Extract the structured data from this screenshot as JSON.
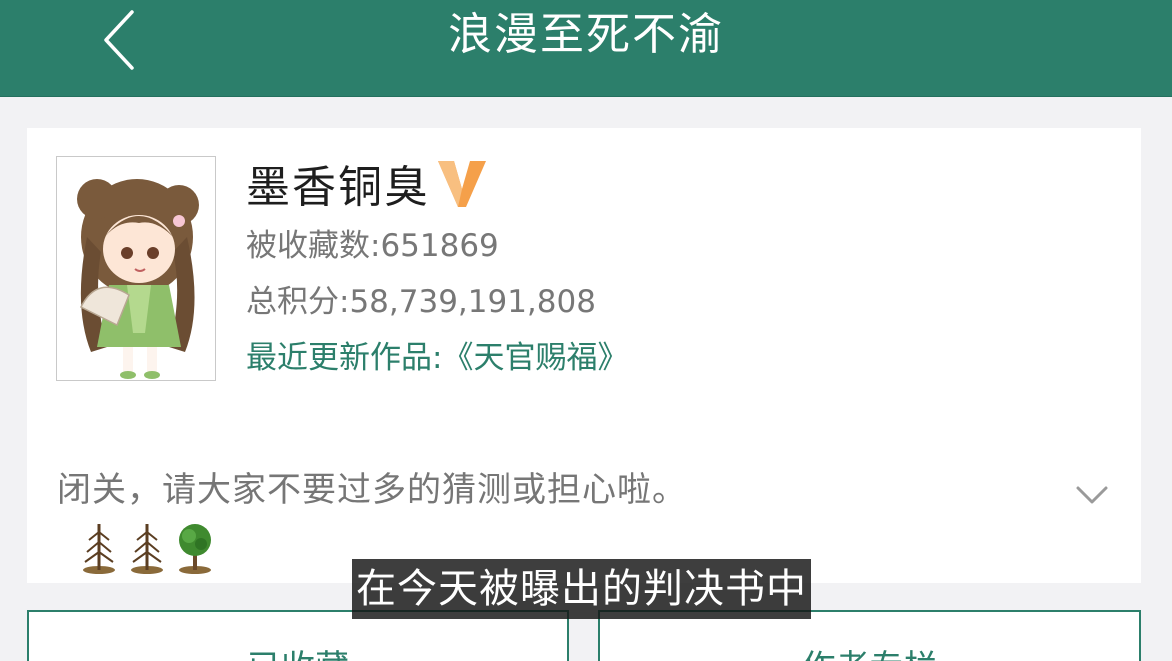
{
  "navbar": {
    "title": "浪漫至死不渝",
    "back_icon": "chevron-left-icon"
  },
  "profile": {
    "name": "墨香铜臭",
    "badge_icon": "vip-v-icon",
    "favorites": "被收藏数:651869",
    "total_score": "总积分:58,739,191,808",
    "latest_work": "最近更新作品:《天官赐福》",
    "bio": "闭关，请大家不要过多的猜测或担心啦。",
    "expand_icon": "chevron-down-icon",
    "tree_icons": [
      "bare-tree-icon",
      "bare-tree-icon",
      "green-tree-icon"
    ]
  },
  "buttons": {
    "left_label": "已收藏",
    "right_label": "作者专栏"
  },
  "subtitle": "在今天被曝出的判决书中",
  "colors": {
    "primary": "#2c7f6b",
    "badge": "#f5a04a",
    "text_muted": "#777777"
  }
}
